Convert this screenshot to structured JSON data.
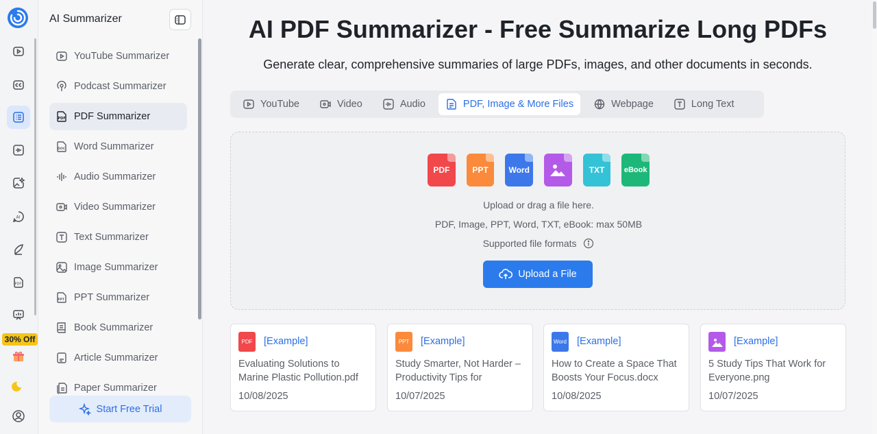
{
  "rail": {
    "promo": "30% Off",
    "icons": [
      "youtube-icon",
      "captions-icon",
      "document-list-icon",
      "audio-wave-icon",
      "image-edit-icon",
      "ai-chat-icon",
      "pen-icon",
      "pdf-icon",
      "presentation-icon",
      "gift-icon",
      "moon-icon",
      "user-icon"
    ]
  },
  "sidebar": {
    "title": "AI Summarizer",
    "items": [
      {
        "label": "YouTube Summarizer",
        "icon": "youtube-icon"
      },
      {
        "label": "Podcast Summarizer",
        "icon": "podcast-icon"
      },
      {
        "label": "PDF Summarizer",
        "icon": "pdf-icon"
      },
      {
        "label": "Word Summarizer",
        "icon": "doc-icon"
      },
      {
        "label": "Audio Summarizer",
        "icon": "audio-icon"
      },
      {
        "label": "Video Summarizer",
        "icon": "video-icon"
      },
      {
        "label": "Text Summarizer",
        "icon": "text-icon"
      },
      {
        "label": "Image Summarizer",
        "icon": "image-icon"
      },
      {
        "label": "PPT Summarizer",
        "icon": "ppt-icon"
      },
      {
        "label": "Book Summarizer",
        "icon": "book-icon"
      },
      {
        "label": "Article Summarizer",
        "icon": "article-icon"
      },
      {
        "label": "Paper Summarizer",
        "icon": "paper-icon"
      }
    ],
    "trial_label": "Start Free Trial"
  },
  "main": {
    "title": "AI PDF Summarizer - Free Summarize Long PDFs",
    "subtitle": "Generate clear, comprehensive summaries of large PDFs, images, and other documents in seconds.",
    "tabs": [
      {
        "label": "YouTube",
        "icon": "youtube-icon"
      },
      {
        "label": "Video",
        "icon": "video-icon"
      },
      {
        "label": "Audio",
        "icon": "audio-icon"
      },
      {
        "label": "PDF, Image & More Files",
        "icon": "file-icon"
      },
      {
        "label": "Webpage",
        "icon": "webpage-icon"
      },
      {
        "label": "Long Text",
        "icon": "text-icon"
      }
    ],
    "upload": {
      "file_types": [
        {
          "label": "PDF",
          "color": "#f0484b"
        },
        {
          "label": "PPT",
          "color": "#fb8a3c"
        },
        {
          "label": "Word",
          "color": "#3d78ea"
        },
        {
          "label": "",
          "color": "#b45ae8"
        },
        {
          "label": "TXT",
          "color": "#33c2d6"
        },
        {
          "label": "eBook",
          "color": "#1db879"
        }
      ],
      "hint1": "Upload or drag a file here.",
      "hint2": "PDF, Image, PPT, Word, TXT, eBook: max 50MB",
      "formats_label": "Supported file formats",
      "button": "Upload a File"
    },
    "examples": [
      {
        "icon_label": "PDF",
        "color": "#f0484b",
        "tag": "[Example]",
        "name": "Evaluating Solutions to Marine Plastic Pollution.pdf",
        "date": "10/08/2025"
      },
      {
        "icon_label": "PPT",
        "color": "#fb8a3c",
        "tag": "[Example]",
        "name": "Study Smarter, Not Harder – Productivity Tips for",
        "date": "10/07/2025"
      },
      {
        "icon_label": "Word",
        "color": "#3d78ea",
        "tag": "[Example]",
        "name": "How to Create a Space That Boosts Your Focus.docx",
        "date": "10/08/2025"
      },
      {
        "icon_label": "",
        "color": "#b45ae8",
        "tag": "[Example]",
        "name": "5 Study Tips That Work for Everyone.png",
        "date": "10/07/2025"
      }
    ]
  }
}
